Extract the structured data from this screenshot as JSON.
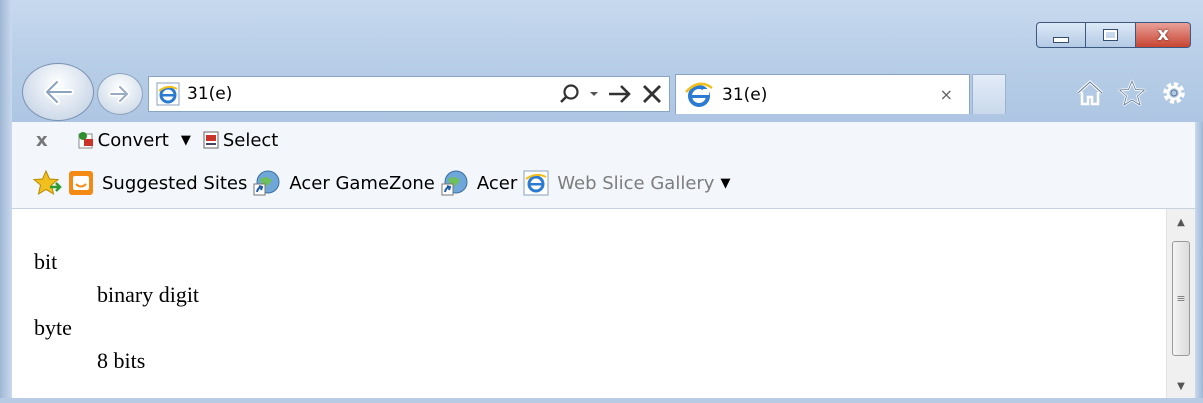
{
  "window": {
    "caption": {
      "minimize_icon": "minimize-icon",
      "maximize_icon": "maximize-icon",
      "close_glyph": "x"
    }
  },
  "nav": {
    "back_icon": "back-arrow-icon",
    "forward_icon": "forward-arrow-icon",
    "address": {
      "value": "31(e)",
      "page_icon": "ie-page-icon"
    },
    "tab": {
      "title": "31(e)",
      "close_glyph": "×"
    },
    "toolbar_icons": [
      "home-icon",
      "favorites-star-icon",
      "tools-gear-icon"
    ]
  },
  "command_bar": {
    "close_glyph": "x",
    "convert_label": "Convert",
    "dropdown_glyph": "▼",
    "select_label": "Select"
  },
  "favorites_bar": {
    "items": [
      {
        "label": "Suggested Sites"
      },
      {
        "label": "Acer GameZone"
      },
      {
        "label": "Acer"
      },
      {
        "label": "Web Slice Gallery",
        "dropdown": "▼"
      }
    ]
  },
  "content": {
    "definitions": [
      {
        "term": "bit",
        "definition": "binary digit"
      },
      {
        "term": "byte",
        "definition": "8 bits"
      }
    ]
  },
  "scrollbar": {
    "up_glyph": "▲",
    "down_glyph": "▼",
    "grip_glyph": "≡"
  },
  "colors": {
    "chrome": "#b9cfe8",
    "close_button": "#c74532",
    "ie_blue": "#2a7bd1",
    "star_gold": "#f2c01e",
    "bing_orange": "#f28a13"
  }
}
